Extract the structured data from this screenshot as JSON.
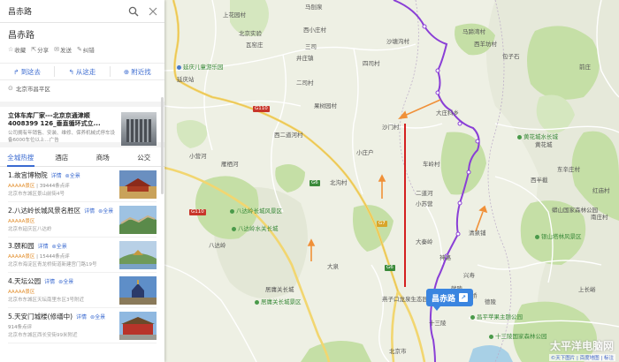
{
  "search": {
    "value": "昌赤路"
  },
  "place": {
    "title": "昌赤路",
    "actions": [
      "收藏",
      "分享",
      "发送",
      "纠错"
    ],
    "route": {
      "to_here": "到这去",
      "from_here": "从这走",
      "nearby": "附近找"
    },
    "region": "北京市昌平区"
  },
  "ad": {
    "title": "立体车库厂家---北京京通津顺4008399 126_垂直循环式立...",
    "desc": "公司拥有年销售、安装、维修、保养机械式停车设备6000车位以上...",
    "tag": "广告"
  },
  "tabs": [
    "全城热搜",
    "酒店",
    "商场",
    "公交"
  ],
  "results": [
    {
      "name": "1.故宫博物院",
      "detail": "详情",
      "pano": "全景",
      "level": "AAAAA景区",
      "rating": "39444条点评",
      "addr": "北京市东城区景山前街4号"
    },
    {
      "name": "2.八达岭长城风景名胜区",
      "detail": "详情",
      "pano": "全景",
      "level": "AAAAA景区",
      "rating": "",
      "addr": "北京市延庆区八达岭"
    },
    {
      "name": "3.颐和园",
      "detail": "详情",
      "pano": "全景",
      "level": "AAAAA景区",
      "rating": "15444条点评",
      "addr": "北京市海淀区青龙桥街道新建宫门路19号"
    },
    {
      "name": "4.天坛公园",
      "detail": "详情",
      "pano": "全景",
      "level": "AAAAA景区",
      "rating": "",
      "addr": "北京市东城区天坛南里东区3号附近"
    },
    {
      "name": "5.天安门城楼(修缮中)",
      "detail": "详情",
      "pano": "全景",
      "level": "",
      "rating": "914条点评",
      "addr": "北京市东城区西长安街99米附近"
    }
  ],
  "map": {
    "marker": "昌赤路",
    "labels": {
      "l1": "上花园村",
      "l2": "北京实验",
      "l3": "瓦窑庄",
      "l4": "马蹄湾村",
      "l5": "西小庄村",
      "l6": "沙塘沟村",
      "l7": "西羊坊村",
      "l8": "井庄镇",
      "l9": "四司村",
      "l10": "延庆儿童游乐园",
      "l11": "二司村",
      "l12": "果树园村",
      "l13": "大庄科乡",
      "l14": "沙门村",
      "l15": "小庄户",
      "l16": "西二道河村",
      "l17": "小营河",
      "l18": "黄花城水长城",
      "l19": "北沟村",
      "l20": "车岭村",
      "l21": "二道河",
      "l22": "小苏营",
      "l23": "八达岭长城风景区",
      "l24": "八达岭水关长城",
      "l25": "大秦岭",
      "l26": "八达岭",
      "l27": "居庸关长城",
      "l28": "居庸关长城景区",
      "l29": "燕子口龙泉生态园",
      "l30": "十三陵",
      "l31": "昌平苹果主题公园",
      "l32": "十三陵国家森林公园",
      "l33": "银山塔林风景区",
      "l34": "上长峪",
      "l35": "延庆站",
      "l36": "大泉",
      "l37": "蟒山国家森林公园",
      "l38": "上万桥",
      "l39": "南庄村",
      "l40": "兴寿",
      "l41": "德陵",
      "l42": "红庙村",
      "l43": "前庄",
      "l44": "黄花城",
      "l45": "包子石",
      "l46": "东辛庄村",
      "l47": "神路",
      "l48": "献陵",
      "l49": "北京市",
      "l50": "清泉铺",
      "l51": "三司",
      "l52": "西半截",
      "l53": "雁栖河",
      "l54": "马刨泉"
    },
    "shields": {
      "s1": "G110",
      "s2": "G6",
      "s3": "G6",
      "s4": "G110",
      "s5": "G7"
    },
    "watermark": "太平洋电脑网",
    "copyright": "©天下图片 | 百度地图 | 标注"
  }
}
